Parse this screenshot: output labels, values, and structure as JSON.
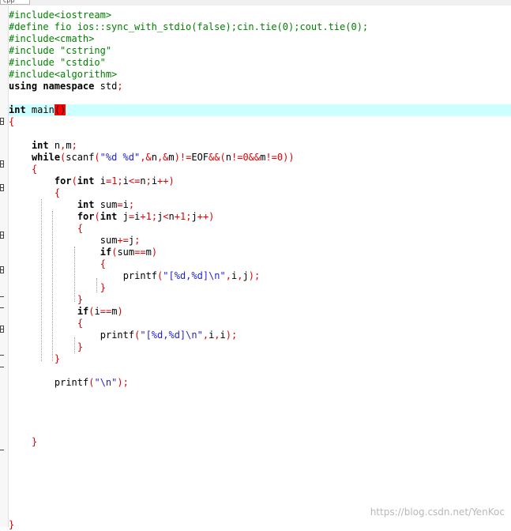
{
  "tab": {
    "label": "cpp"
  },
  "lines": [
    "#include<iostream>",
    "#define fio ios::sync_with_stdio(false);cin.tie(0);cout.tie(0);",
    "#include<cmath>",
    "#include \"cstring\"",
    "#include \"cstdio\"",
    "#include<algorithm>",
    "using namespace std;",
    "",
    "int main()",
    "{",
    "",
    "    int n,m;",
    "    while(scanf(\"%d %d\",&n,&m)!=EOF&&(n!=0&&m!=0))",
    "    {",
    "        for(int i=1;i<=n;i++)",
    "        {",
    "            int sum=i;",
    "            for(int j=i+1;j<n+1;j++)",
    "            {",
    "                sum+=j;",
    "                if(sum==m)",
    "                {",
    "                    printf(\"[%d,%d]\\n\",i,j);",
    "                }",
    "            }",
    "            if(i==m)",
    "            {",
    "                printf(\"[%d,%d]\\n\",i,i);",
    "            }",
    "        }",
    "",
    "        printf(\"\\n\");",
    "",
    "",
    "",
    "",
    "    }",
    "",
    "",
    "",
    "",
    "",
    "",
    "}"
  ],
  "watermark": "https://blog.csdn.net/YenKoc",
  "colors": {
    "preprocessor": "#008000",
    "keyword": "#000000",
    "string": "#1f1fd1",
    "operator": "#e00000",
    "current_line": "#ccffff",
    "brace_match": "#ff0000"
  }
}
